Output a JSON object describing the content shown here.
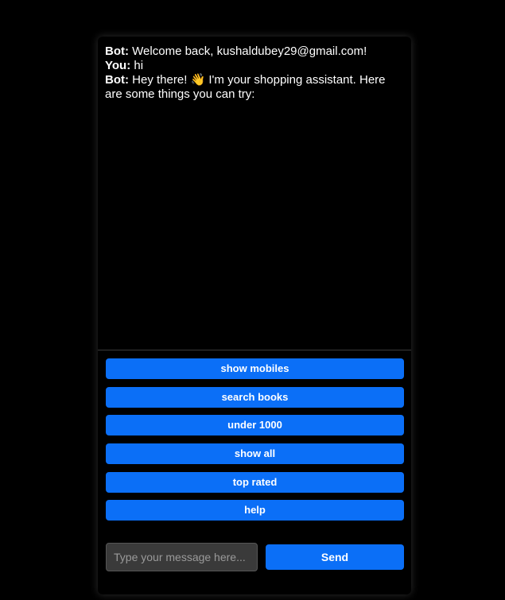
{
  "chat": {
    "messages": [
      {
        "sender": "Bot:",
        "text": " Welcome back, kushaldubey29@gmail.com!"
      },
      {
        "sender": "You:",
        "text": " hi"
      },
      {
        "sender": "Bot:",
        "text": " Hey there! 👋 I'm your shopping assistant. Here are some things you can try:"
      }
    ]
  },
  "suggestions": [
    {
      "label": "show mobiles"
    },
    {
      "label": "search books"
    },
    {
      "label": "under 1000"
    },
    {
      "label": "show all"
    },
    {
      "label": "top rated"
    },
    {
      "label": "help"
    }
  ],
  "input": {
    "placeholder": "Type your message here...",
    "value": ""
  },
  "send": {
    "label": "Send"
  },
  "colors": {
    "background": "#000000",
    "accent": "#0b6ff7",
    "input_background": "#3a3a3a"
  }
}
